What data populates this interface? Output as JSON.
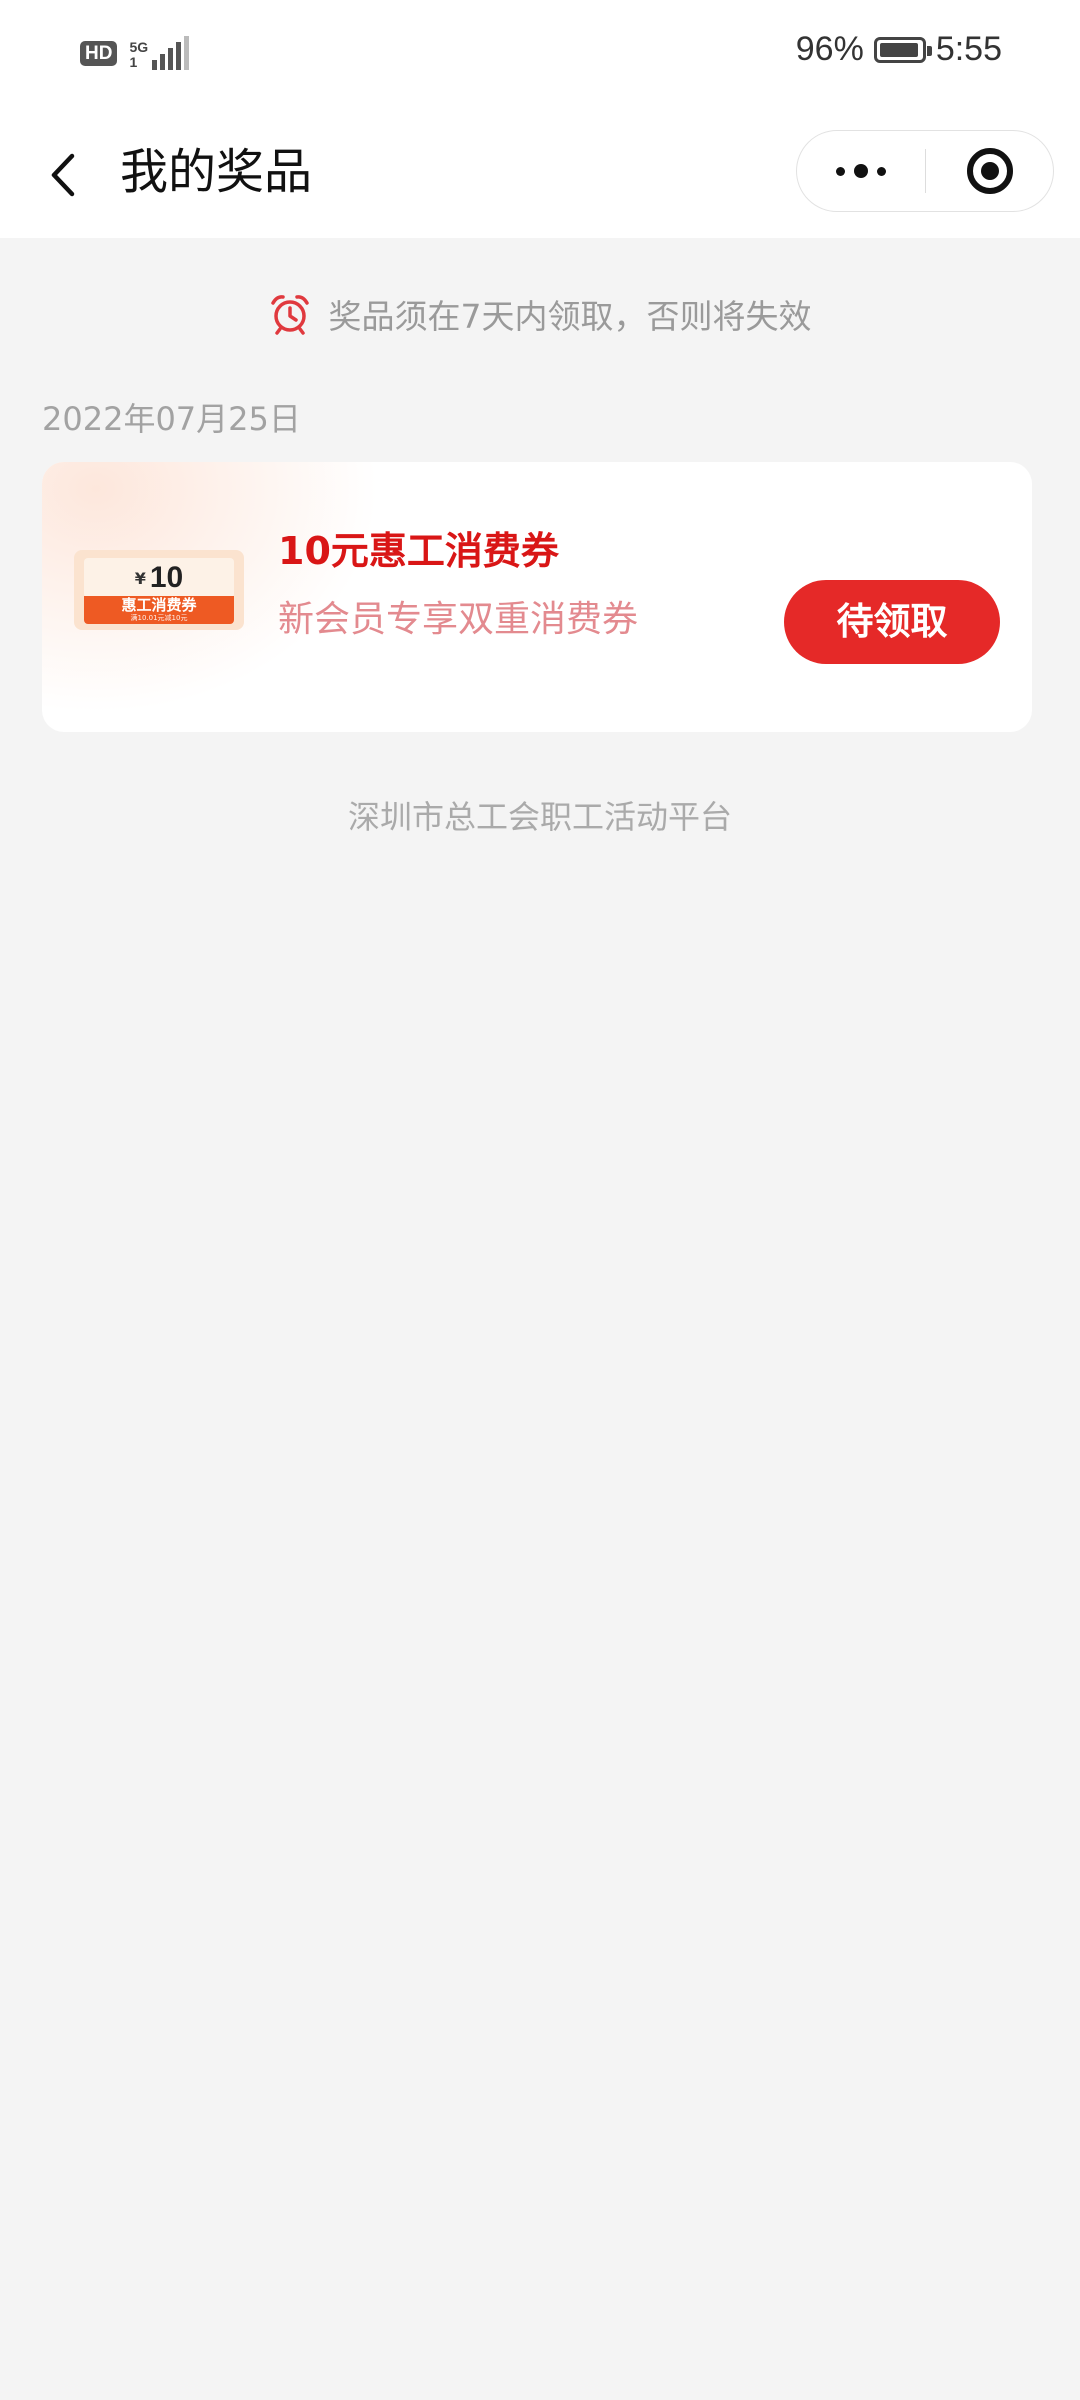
{
  "status_bar": {
    "hd_label": "HD",
    "network_label": "5G",
    "network_sub": "1",
    "battery_percent": "96%",
    "battery_level": 96,
    "time": "5:55"
  },
  "nav": {
    "title": "我的奖品"
  },
  "notice": {
    "text": "奖品须在7天内领取，否则将失效",
    "icon": "alarm-clock-icon",
    "color": "#e0393e"
  },
  "prize_group": {
    "date": "2022年07月25日",
    "items": [
      {
        "thumb": {
          "currency": "¥",
          "amount": "10",
          "label": "惠工消费券",
          "sub_label": "满10.01元减10元"
        },
        "name": "10元惠工消费券",
        "description": "新会员专享双重消费券",
        "button_label": "待领取"
      }
    ]
  },
  "footer": {
    "text": "深圳市总工会职工活动平台"
  },
  "colors": {
    "accent": "#e52928",
    "prize_name": "#d91616",
    "prize_desc": "#e38a8f",
    "background": "#f4f4f4"
  }
}
